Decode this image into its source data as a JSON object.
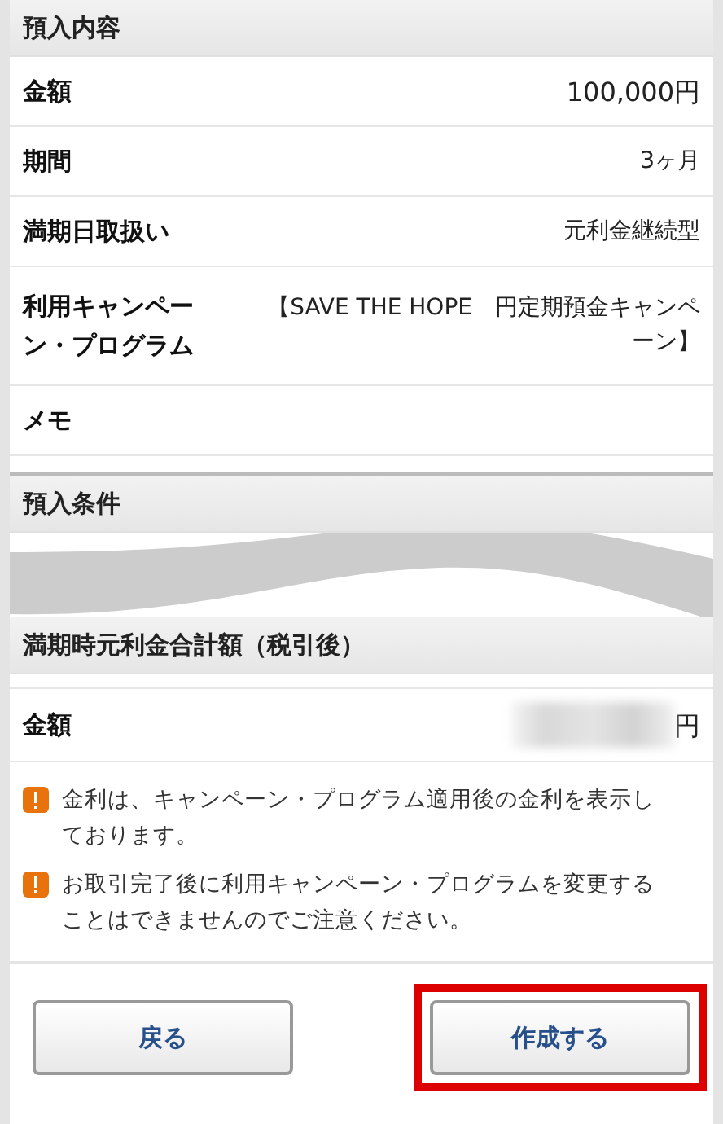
{
  "deposit_section": {
    "title": "預入内容",
    "rows": [
      {
        "label": "金額",
        "value": "100,000円",
        "kind": "amount"
      },
      {
        "label": "期間",
        "value": "3ヶ月",
        "kind": "text"
      },
      {
        "label": "満期日取扱い",
        "value": "元利金継続型",
        "kind": "text"
      },
      {
        "label": "利用キャンペーン・プログラム",
        "value": "【SAVE THE HOPE　円定期預金キャンペーン】",
        "kind": "campaign"
      },
      {
        "label": "メモ",
        "kind": "memo"
      }
    ]
  },
  "conditions_section": {
    "title": "預入条件"
  },
  "maturity_section": {
    "title": "満期時元利金合計額（税引後）",
    "rows": [
      {
        "label": "金額",
        "unit": "円",
        "value_hidden": true
      }
    ]
  },
  "notes": [
    "金利は、キャンペーン・プログラム適用後の金利を表示しております。",
    "お取引完了後に利用キャンペーン・プログラムを変更することはできませんのでご注意ください。"
  ],
  "buttons": [
    {
      "label": "戻る",
      "highlighted": false
    },
    {
      "label": "作成する",
      "highlighted": true
    }
  ]
}
